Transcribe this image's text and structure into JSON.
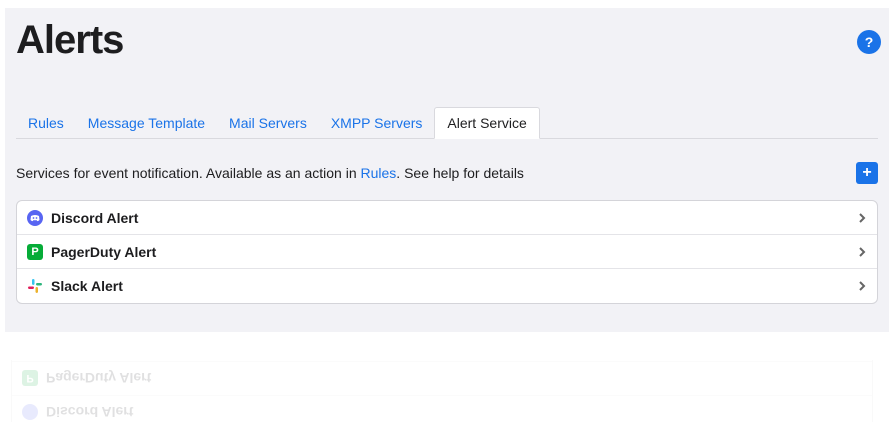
{
  "page": {
    "title": "Alerts",
    "help_label": "?"
  },
  "tabs": [
    {
      "label": "Rules",
      "active": false
    },
    {
      "label": "Message Template",
      "active": false
    },
    {
      "label": "Mail Servers",
      "active": false
    },
    {
      "label": "XMPP Servers",
      "active": false
    },
    {
      "label": "Alert Service",
      "active": true
    }
  ],
  "description": {
    "prefix": "Services for event notification. Available as an action in ",
    "link": "Rules",
    "suffix": ". See help for details"
  },
  "add_label": "+",
  "services": [
    {
      "label": "Discord Alert",
      "icon": "discord-icon"
    },
    {
      "label": "PagerDuty Alert",
      "icon": "pagerduty-icon"
    },
    {
      "label": "Slack Alert",
      "icon": "slack-icon"
    }
  ],
  "colors": {
    "accent": "#1a73e8",
    "discord": "#5865f2",
    "pagerduty": "#06ac38",
    "background": "#f2f2f6"
  }
}
